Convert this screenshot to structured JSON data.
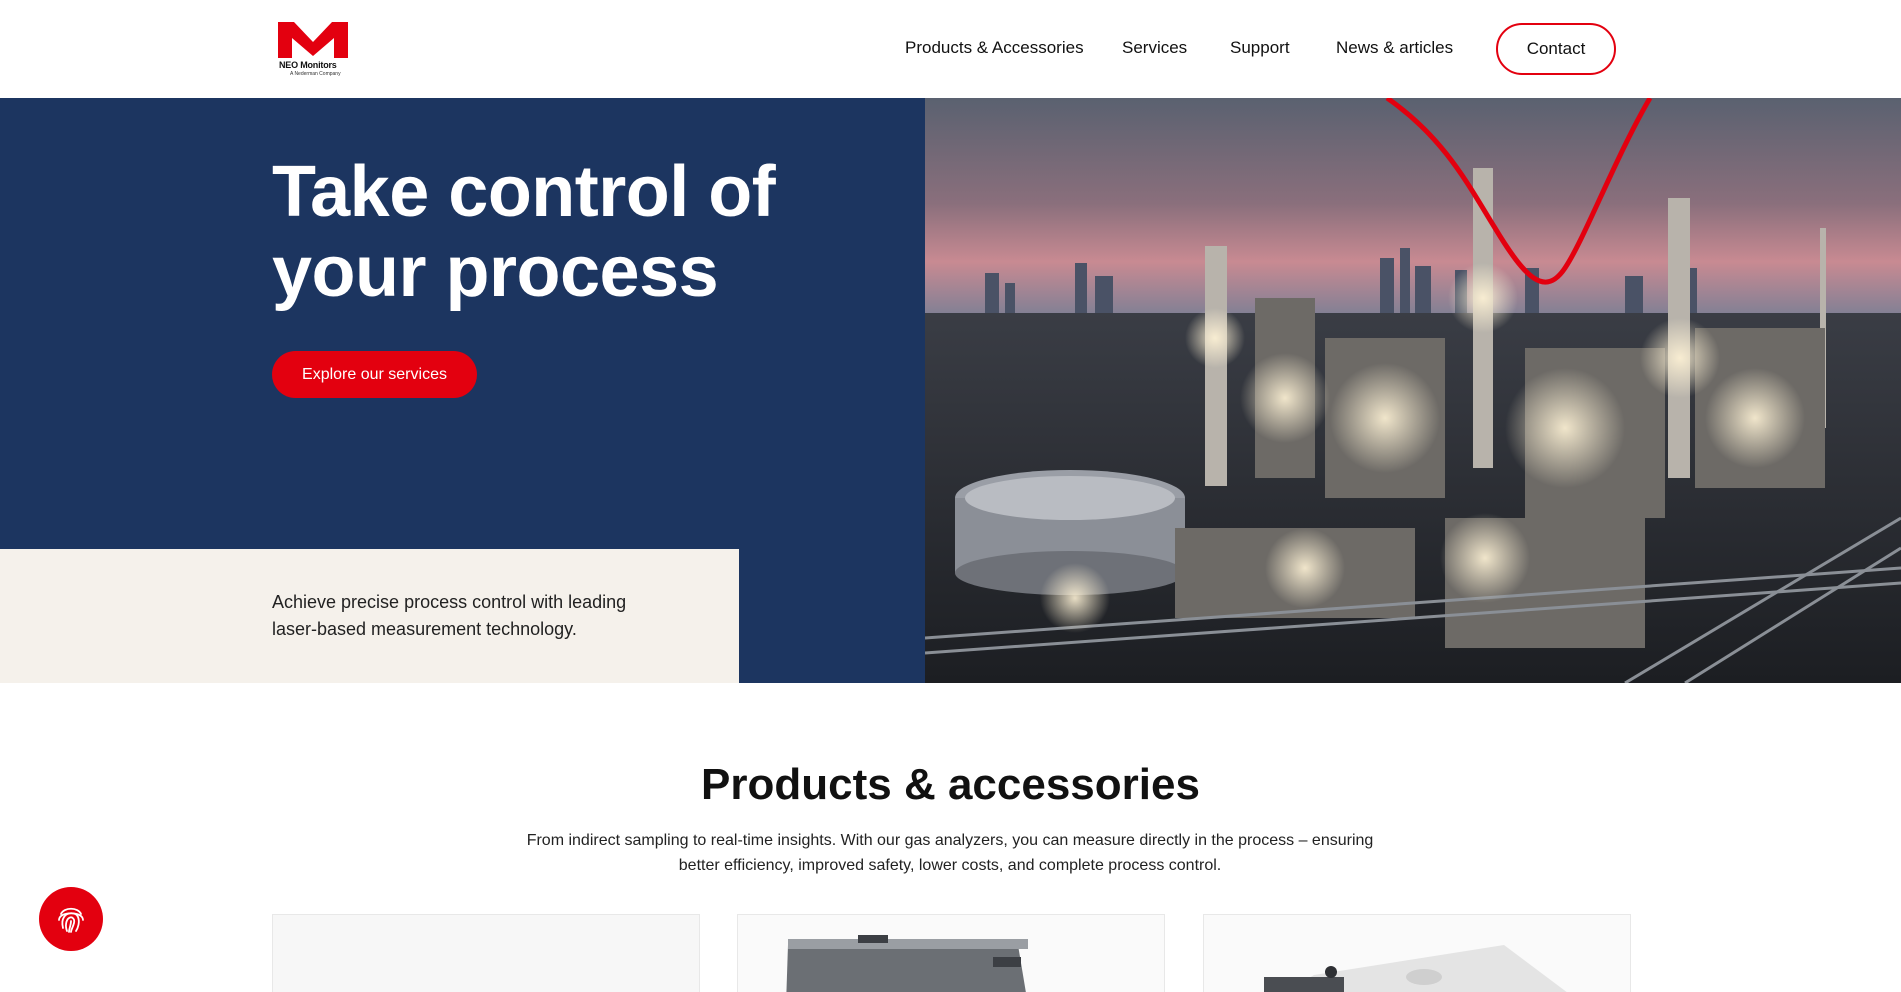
{
  "header": {
    "logo_text": "NEO Monitors",
    "logo_subtext": "A Nederman Company",
    "nav": [
      "Products & Accessories",
      "Services",
      "Support",
      "News & articles"
    ],
    "contact_label": "Contact"
  },
  "hero": {
    "title_line1": "Take control of",
    "title_line2": "your process",
    "cta_label": "Explore our services",
    "description": "Achieve precise process control with leading laser-based measurement technology."
  },
  "products": {
    "title": "Products & accessories",
    "description": "From indirect sampling to real-time insights. With our gas analyzers, you can measure directly in the process – ensuring better efficiency, improved safety, lower costs, and complete process control."
  },
  "colors": {
    "brand_red": "#e3000f",
    "navy": "#1c3560",
    "cream": "#f5f1eb"
  },
  "icons": [
    "fingerprint-icon"
  ]
}
